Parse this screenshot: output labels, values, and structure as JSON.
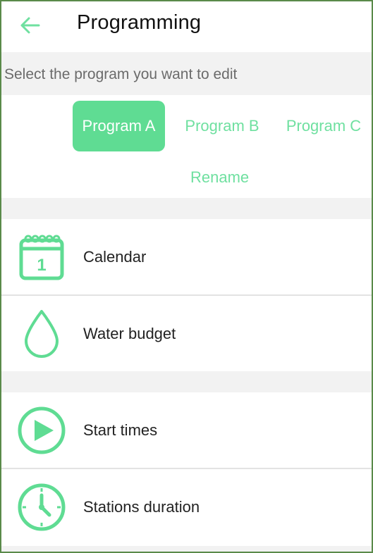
{
  "header": {
    "title": "Programming",
    "back_icon": "arrow-left-icon"
  },
  "subtitle": "Select the program you want to edit",
  "programs": {
    "items": [
      {
        "label": "Program A",
        "active": true
      },
      {
        "label": "Program B",
        "active": false
      },
      {
        "label": "Program C",
        "active": false
      }
    ],
    "rename_label": "Rename"
  },
  "menu": {
    "calendar": {
      "label": "Calendar",
      "icon": "calendar-icon",
      "icon_text": "1"
    },
    "water_budget": {
      "label": "Water budget",
      "icon": "water-drop-icon"
    },
    "start_times": {
      "label": "Start times",
      "icon": "play-icon"
    },
    "stations_duration": {
      "label": "Stations duration",
      "icon": "clock-icon"
    }
  },
  "colors": {
    "accent": "#5fdc93",
    "accent_text": "#6fe0a0",
    "background": "#f2f2f2"
  }
}
